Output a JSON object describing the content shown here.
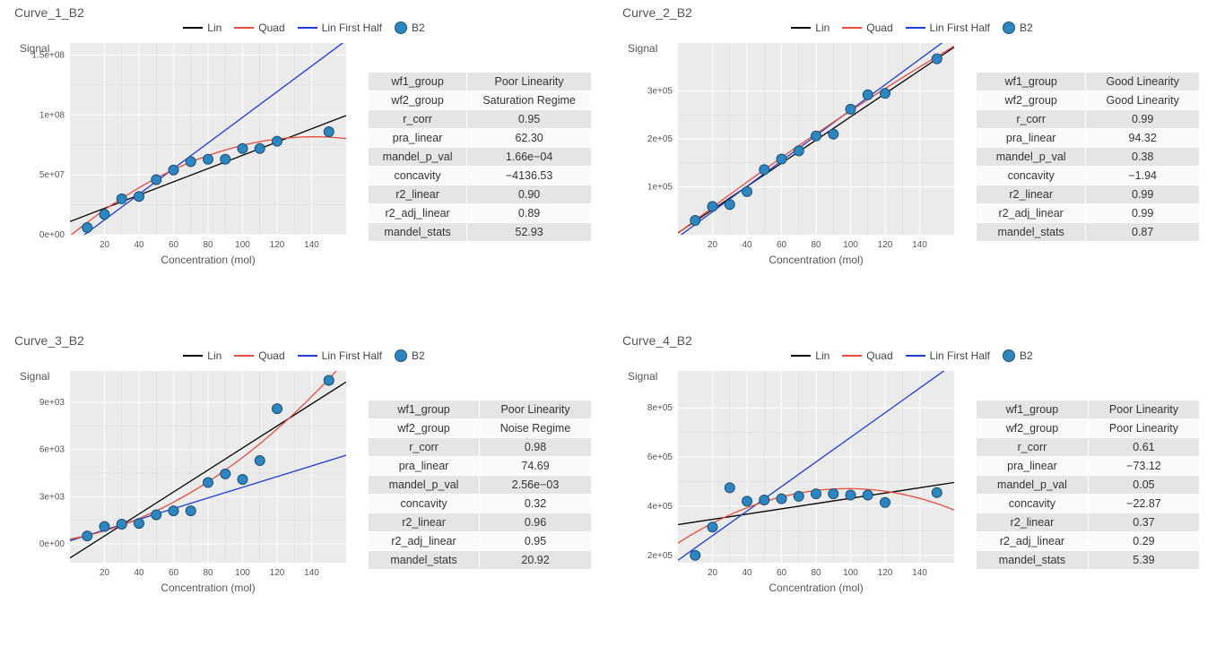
{
  "legend": {
    "lin": "Lin",
    "quad": "Quad",
    "half": "Lin First Half",
    "series": "B2"
  },
  "axis": {
    "x": "Concentration (mol)",
    "y": "Signal"
  },
  "stat_keys": [
    "wf1_group",
    "wf2_group",
    "r_corr",
    "pra_linear",
    "mandel_p_val",
    "concavity",
    "r2_linear",
    "r2_adj_linear",
    "mandel_stats"
  ],
  "panels": [
    {
      "id": "c1",
      "title": "Curve_1_B2",
      "stats": [
        "Poor Linearity",
        "Saturation Regime",
        "0.95",
        "62.30",
        "1.66e−04",
        "−4136.53",
        "0.90",
        "0.89",
        "52.93"
      ]
    },
    {
      "id": "c2",
      "title": "Curve_2_B2",
      "stats": [
        "Good Linearity",
        "Good Linearity",
        "0.99",
        "94.32",
        "0.38",
        "−1.94",
        "0.99",
        "0.99",
        "0.87"
      ]
    },
    {
      "id": "c3",
      "title": "Curve_3_B2",
      "stats": [
        "Poor Linearity",
        "Noise Regime",
        "0.98",
        "74.69",
        "2.56e−03",
        "0.32",
        "0.96",
        "0.95",
        "20.92"
      ]
    },
    {
      "id": "c4",
      "title": "Curve_4_B2",
      "stats": [
        "Poor Linearity",
        "Poor Linearity",
        "0.61",
        "−73.12",
        "0.05",
        "−22.87",
        "0.37",
        "0.29",
        "5.39"
      ]
    }
  ],
  "chart_data": [
    {
      "id": "c1",
      "type": "scatter",
      "title": "Curve_1_B2",
      "xlabel": "Concentration (mol)",
      "ylabel": "Signal",
      "xlim": [
        0,
        160
      ],
      "ylim": [
        0,
        160000000.0
      ],
      "x_ticks": [
        20,
        40,
        60,
        80,
        100,
        120,
        140
      ],
      "y_ticks": [
        {
          "v": 0,
          "l": "0e+00"
        },
        {
          "v": 50000000.0,
          "l": "5e+07"
        },
        {
          "v": 100000000.0,
          "l": "1e+08"
        },
        {
          "v": 150000000.0,
          "l": "1.5e+08"
        }
      ],
      "points": {
        "x": [
          10,
          20,
          30,
          40,
          50,
          60,
          70,
          80,
          90,
          100,
          110,
          120,
          150
        ],
        "y": [
          6000000.0,
          17000000.0,
          30000000.0,
          32000000.0,
          46000000.0,
          54000000.0,
          61000000.0,
          63000000.0,
          63000000.0,
          72000000.0,
          72000000.0,
          78000000.0,
          86000000.0
        ]
      },
      "lin": {
        "a": 553000,
        "b": 11000000.0
      },
      "half": {
        "a": 1070000.0,
        "b": -9000000.0
      },
      "quad": {
        "a": -4136,
        "b": 1170000.0,
        "c": -1000000.0
      }
    },
    {
      "id": "c2",
      "type": "scatter",
      "title": "Curve_2_B2",
      "xlabel": "Concentration (mol)",
      "ylabel": "Signal",
      "xlim": [
        0,
        160
      ],
      "ylim": [
        0,
        400000.0
      ],
      "x_ticks": [
        20,
        40,
        60,
        80,
        100,
        120,
        140
      ],
      "y_ticks": [
        {
          "v": 100000.0,
          "l": "1e+05"
        },
        {
          "v": 200000.0,
          "l": "2e+05"
        },
        {
          "v": 300000.0,
          "l": "3e+05"
        }
      ],
      "points": {
        "x": [
          10,
          20,
          30,
          40,
          50,
          60,
          70,
          80,
          90,
          100,
          110,
          120,
          150
        ],
        "y": [
          30000.0,
          59000.0,
          63000.0,
          90000.0,
          136000.0,
          158000.0,
          175000.0,
          206000.0,
          210000.0,
          262000.0,
          292000.0,
          295000.0,
          367000.0
        ]
      },
      "lin": {
        "a": 2420,
        "b": 4000
      },
      "half": {
        "a": 2650,
        "b": -5000
      },
      "quad": {
        "a": -1.94,
        "b": 2750,
        "c": 3000
      }
    },
    {
      "id": "c3",
      "type": "scatter",
      "title": "Curve_3_B2",
      "xlabel": "Concentration (mol)",
      "ylabel": "Signal",
      "xlim": [
        0,
        160
      ],
      "ylim": [
        -1200,
        11000
      ],
      "x_ticks": [
        20,
        40,
        60,
        80,
        100,
        120,
        140
      ],
      "y_ticks": [
        {
          "v": 0,
          "l": "0e+00"
        },
        {
          "v": 3000,
          "l": "3e+03"
        },
        {
          "v": 6000,
          "l": "6e+03"
        },
        {
          "v": 9000,
          "l": "9e+03"
        }
      ],
      "points": {
        "x": [
          10,
          20,
          30,
          40,
          50,
          60,
          70,
          80,
          90,
          100,
          110,
          120,
          150
        ],
        "y": [
          500,
          1100,
          1250,
          1300,
          1850,
          2100,
          2100,
          3900,
          4450,
          4100,
          5300,
          8600,
          10400
        ]
      },
      "lin": {
        "a": 70,
        "b": -900
      },
      "half": {
        "a": 34,
        "b": 200
      },
      "quad": {
        "a": 0.32,
        "b": 20,
        "c": 300
      }
    },
    {
      "id": "c4",
      "type": "scatter",
      "title": "Curve_4_B2",
      "xlabel": "Concentration (mol)",
      "ylabel": "Signal",
      "xlim": [
        0,
        160
      ],
      "ylim": [
        170000.0,
        950000.0
      ],
      "x_ticks": [
        20,
        40,
        60,
        80,
        100,
        120,
        140
      ],
      "y_ticks": [
        {
          "v": 200000.0,
          "l": "2e+05"
        },
        {
          "v": 400000.0,
          "l": "4e+05"
        },
        {
          "v": 600000.0,
          "l": "6e+05"
        },
        {
          "v": 800000.0,
          "l": "8e+05"
        }
      ],
      "points": {
        "x": [
          10,
          20,
          30,
          40,
          50,
          60,
          70,
          80,
          90,
          100,
          110,
          120,
          150
        ],
        "y": [
          200000.0,
          315000.0,
          475000.0,
          420000.0,
          425000.0,
          430000.0,
          440000.0,
          450000.0,
          450000.0,
          445000.0,
          445000.0,
          415000.0,
          455000.0
        ]
      },
      "lin": {
        "a": 1070,
        "b": 325000.0
      },
      "half": {
        "a": 5000,
        "b": 180000.0
      },
      "quad": {
        "a": -22.87,
        "b": 4500,
        "c": 250000.0
      }
    }
  ]
}
